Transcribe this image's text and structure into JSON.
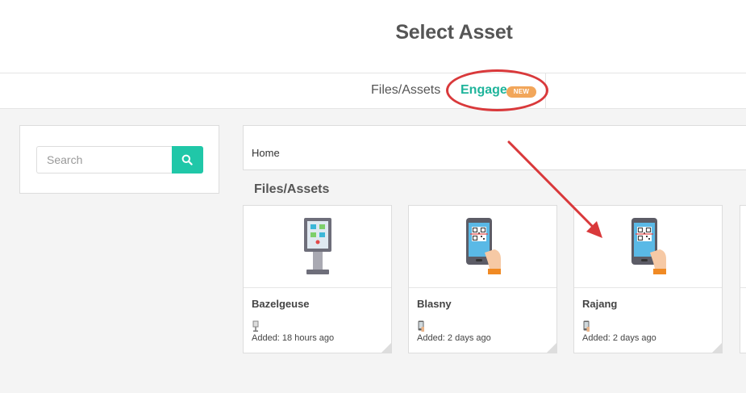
{
  "header": {
    "title": "Select Asset"
  },
  "tabs": {
    "files_label": "Files/Assets",
    "engage_label": "Engage",
    "engage_badge": "NEW"
  },
  "search": {
    "placeholder": "Search",
    "button_icon": "search-icon"
  },
  "breadcrumb": {
    "home": "Home"
  },
  "section": {
    "title": "Files/Assets"
  },
  "cards": [
    {
      "name": "Bazelgeuse",
      "added": "Added: 18 hours ago",
      "thumb_icon": "kiosk-icon",
      "type_icon": "kiosk-small-icon"
    },
    {
      "name": "Blasny",
      "added": "Added: 2 days ago",
      "thumb_icon": "phone-qr-icon",
      "type_icon": "phone-small-icon"
    },
    {
      "name": "Rajang",
      "added": "Added: 2 days ago",
      "thumb_icon": "phone-qr-icon",
      "type_icon": "phone-small-icon"
    }
  ],
  "colors": {
    "accent": "#20c7a8",
    "engage_text": "#1fb49b",
    "badge": "#f2a65a",
    "annotation_red": "#d9393b"
  }
}
